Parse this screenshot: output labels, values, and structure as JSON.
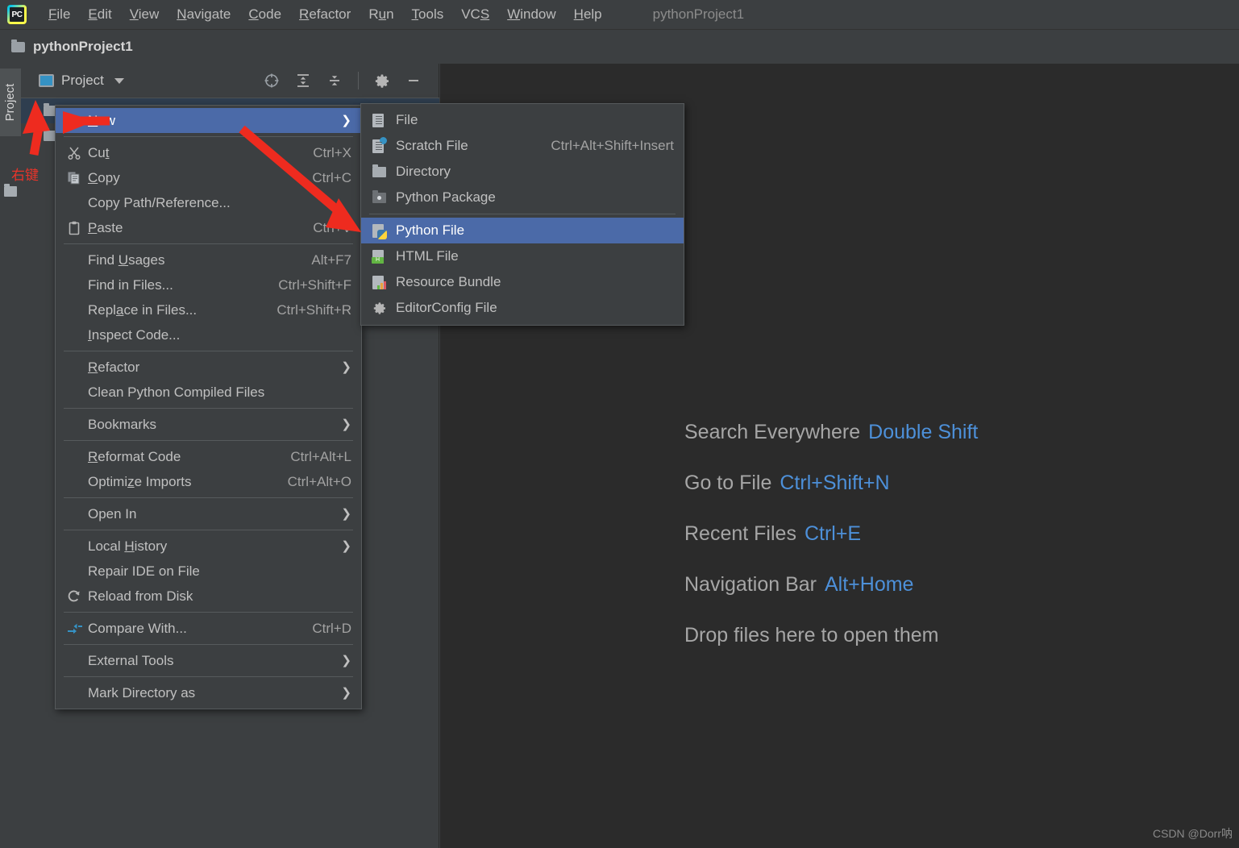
{
  "window": {
    "title": "pythonProject1",
    "logo_text": "PC",
    "logo_name": "pycharm-logo"
  },
  "menubar": {
    "items": [
      {
        "label": "File",
        "mnemonic": "F"
      },
      {
        "label": "Edit",
        "mnemonic": "E"
      },
      {
        "label": "View",
        "mnemonic": "V"
      },
      {
        "label": "Navigate",
        "mnemonic": "N"
      },
      {
        "label": "Code",
        "mnemonic": "C"
      },
      {
        "label": "Refactor",
        "mnemonic": "R"
      },
      {
        "label": "Run",
        "mnemonic": "u"
      },
      {
        "label": "Tools",
        "mnemonic": "T"
      },
      {
        "label": "VCS",
        "mnemonic": "S"
      },
      {
        "label": "Window",
        "mnemonic": "W"
      },
      {
        "label": "Help",
        "mnemonic": "H"
      }
    ]
  },
  "project_header": {
    "name": "pythonProject1",
    "folder_icon": "folder-icon"
  },
  "tool_strip": {
    "tab_label": "Project",
    "folder_icon": "folder-icon"
  },
  "project_panel": {
    "view_label": "Project",
    "view_icon": "project-view-icon",
    "dropdown_icon": "chevron-down-icon",
    "actions": [
      {
        "name": "select-opened-file-icon",
        "title": "Select Opened File"
      },
      {
        "name": "expand-all-icon",
        "title": "Expand All"
      },
      {
        "name": "collapse-all-icon",
        "title": "Collapse All"
      },
      {
        "name": "settings-gear-icon",
        "title": "Options"
      },
      {
        "name": "hide-icon",
        "title": "Hide"
      }
    ],
    "tree_rows": [
      {
        "chevron": "›",
        "label": "",
        "selected": true
      },
      {
        "chevron": "›",
        "label": "",
        "selected": false
      }
    ]
  },
  "context_menu": {
    "items": [
      {
        "label": "New",
        "mnemonic": "N",
        "shortcut": "",
        "submenu": true,
        "highlighted": true,
        "icon": "",
        "sep_after": true
      },
      {
        "label": "Cut",
        "mnemonic": "t",
        "shortcut": "Ctrl+X",
        "submenu": false,
        "highlighted": false,
        "icon": "scissors-icon"
      },
      {
        "label": "Copy",
        "mnemonic": "C",
        "shortcut": "Ctrl+C",
        "submenu": false,
        "highlighted": false,
        "icon": "copy-icon"
      },
      {
        "label": "Copy Path/Reference...",
        "mnemonic": "",
        "shortcut": "",
        "submenu": false,
        "highlighted": false,
        "icon": ""
      },
      {
        "label": "Paste",
        "mnemonic": "P",
        "shortcut": "Ctrl+V",
        "submenu": false,
        "highlighted": false,
        "icon": "clipboard-icon",
        "sep_after": true
      },
      {
        "label": "Find Usages",
        "mnemonic": "U",
        "shortcut": "Alt+F7",
        "submenu": false,
        "highlighted": false,
        "icon": ""
      },
      {
        "label": "Find in Files...",
        "mnemonic": "",
        "shortcut": "Ctrl+Shift+F",
        "submenu": false,
        "highlighted": false,
        "icon": ""
      },
      {
        "label": "Replace in Files...",
        "mnemonic": "a",
        "shortcut": "Ctrl+Shift+R",
        "submenu": false,
        "highlighted": false,
        "icon": ""
      },
      {
        "label": "Inspect Code...",
        "mnemonic": "I",
        "shortcut": "",
        "submenu": false,
        "highlighted": false,
        "icon": "",
        "sep_after": true
      },
      {
        "label": "Refactor",
        "mnemonic": "R",
        "shortcut": "",
        "submenu": true,
        "highlighted": false,
        "icon": ""
      },
      {
        "label": "Clean Python Compiled Files",
        "mnemonic": "",
        "shortcut": "",
        "submenu": false,
        "highlighted": false,
        "icon": "",
        "sep_after": true
      },
      {
        "label": "Bookmarks",
        "mnemonic": "",
        "shortcut": "",
        "submenu": true,
        "highlighted": false,
        "icon": "",
        "sep_after": true
      },
      {
        "label": "Reformat Code",
        "mnemonic": "R",
        "shortcut": "Ctrl+Alt+L",
        "submenu": false,
        "highlighted": false,
        "icon": ""
      },
      {
        "label": "Optimize Imports",
        "mnemonic": "z",
        "shortcut": "Ctrl+Alt+O",
        "submenu": false,
        "highlighted": false,
        "icon": "",
        "sep_after": true
      },
      {
        "label": "Open In",
        "mnemonic": "",
        "shortcut": "",
        "submenu": true,
        "highlighted": false,
        "icon": "",
        "sep_after": true
      },
      {
        "label": "Local History",
        "mnemonic": "H",
        "shortcut": "",
        "submenu": true,
        "highlighted": false,
        "icon": ""
      },
      {
        "label": "Repair IDE on File",
        "mnemonic": "",
        "shortcut": "",
        "submenu": false,
        "highlighted": false,
        "icon": ""
      },
      {
        "label": "Reload from Disk",
        "mnemonic": "",
        "shortcut": "",
        "submenu": false,
        "highlighted": false,
        "icon": "reload-icon",
        "sep_after": true
      },
      {
        "label": "Compare With...",
        "mnemonic": "",
        "shortcut": "Ctrl+D",
        "submenu": false,
        "highlighted": false,
        "icon": "compare-icon",
        "sep_after": true
      },
      {
        "label": "External Tools",
        "mnemonic": "",
        "shortcut": "",
        "submenu": true,
        "highlighted": false,
        "icon": "",
        "sep_after": true
      },
      {
        "label": "Mark Directory as",
        "mnemonic": "",
        "shortcut": "",
        "submenu": true,
        "highlighted": false,
        "icon": ""
      }
    ]
  },
  "submenu_new": {
    "items": [
      {
        "label": "File",
        "shortcut": "",
        "icon": "file-icon",
        "highlighted": false
      },
      {
        "label": "Scratch File",
        "shortcut": "Ctrl+Alt+Shift+Insert",
        "icon": "scratch-file-icon",
        "highlighted": false
      },
      {
        "label": "Directory",
        "shortcut": "",
        "icon": "directory-icon",
        "highlighted": false
      },
      {
        "label": "Python Package",
        "shortcut": "",
        "icon": "python-package-icon",
        "highlighted": false,
        "sep_after": true
      },
      {
        "label": "Python File",
        "shortcut": "",
        "icon": "python-file-icon",
        "highlighted": true
      },
      {
        "label": "HTML File",
        "shortcut": "",
        "icon": "html-file-icon",
        "highlighted": false
      },
      {
        "label": "Resource Bundle",
        "shortcut": "",
        "icon": "resource-bundle-icon",
        "highlighted": false
      },
      {
        "label": "EditorConfig File",
        "shortcut": "",
        "icon": "editorconfig-icon",
        "highlighted": false
      }
    ]
  },
  "editor_hints": {
    "rows": [
      {
        "label": "Search Everywhere",
        "key": "Double Shift"
      },
      {
        "label": "Go to File",
        "key": "Ctrl+Shift+N"
      },
      {
        "label": "Recent Files",
        "key": "Ctrl+E"
      },
      {
        "label": "Navigation Bar",
        "key": "Alt+Home"
      },
      {
        "label": "Drop files here to open them",
        "key": ""
      }
    ]
  },
  "annotations": {
    "right_click_label": "右键",
    "arrow_color": "#ee2b1f"
  },
  "watermark": {
    "text": "CSDN @Dorr呐"
  },
  "colors": {
    "chrome": "#3c3f41",
    "editor_bg": "#2b2b2b",
    "menu_highlight": "#4b6aa8",
    "tree_selection": "#2f3e4f",
    "accent_blue": "#4d90d9",
    "text": "#bbbbbb",
    "annotation_red": "#ee2b1f"
  }
}
